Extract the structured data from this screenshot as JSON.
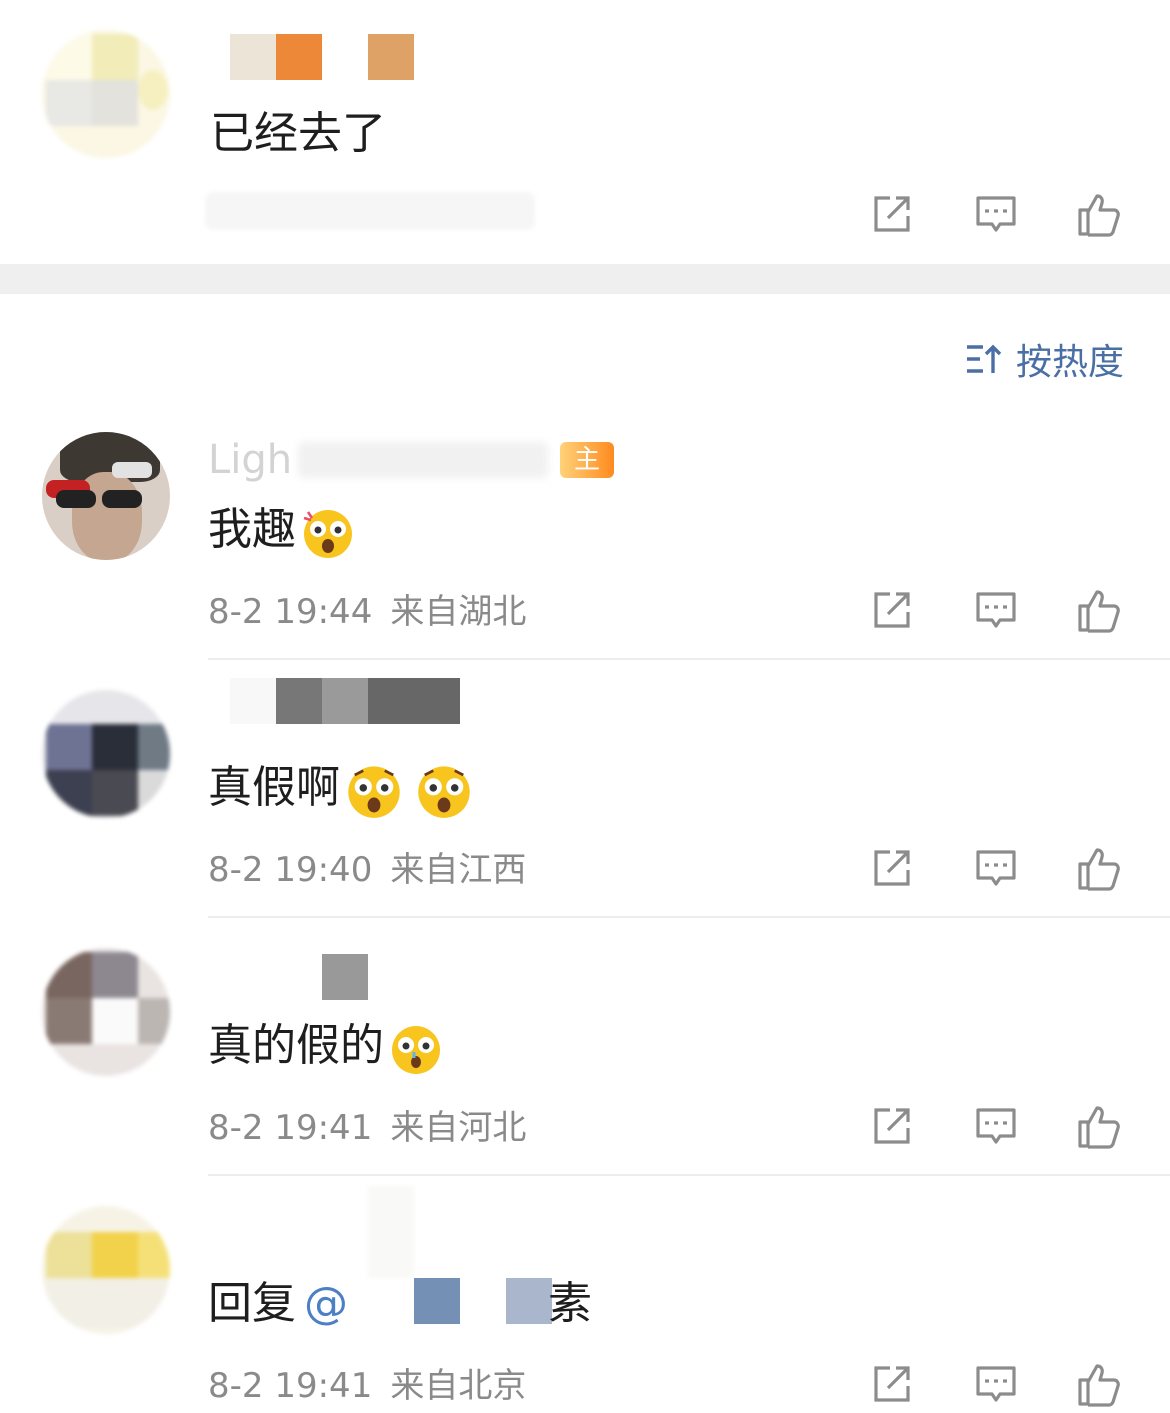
{
  "comments_top": {
    "text": "已经去了"
  },
  "sort": {
    "label": "按热度",
    "icon": "sort-icon"
  },
  "comments": [
    {
      "username": "Ligh",
      "badge": "主",
      "text": "我趣",
      "emoji": [
        "surprised-emoji"
      ],
      "date": "8-2 19:44",
      "location": "来自湖北"
    },
    {
      "text": "真假啊",
      "emoji": [
        "surprised-emoji",
        "surprised-emoji"
      ],
      "date": "8-2 19:40",
      "location": "来自江西"
    },
    {
      "text": "真的假的",
      "emoji": [
        "shocked-emoji"
      ],
      "date": "8-2 19:41",
      "location": "来自河北"
    },
    {
      "reply_prefix": "回复",
      "mention": "@",
      "text_suffix": "素",
      "date": "8-2 19:41",
      "location": "来自北京"
    }
  ],
  "actions": {
    "share_icon": "share-icon",
    "comment_icon": "comment-icon",
    "like_icon": "like-icon"
  },
  "colors": {
    "meta": "#8a8a8a",
    "sort": "#4a6fa5",
    "mention": "#4d7fc4",
    "badge": "#ff8a1f",
    "separator": "#efefef"
  }
}
